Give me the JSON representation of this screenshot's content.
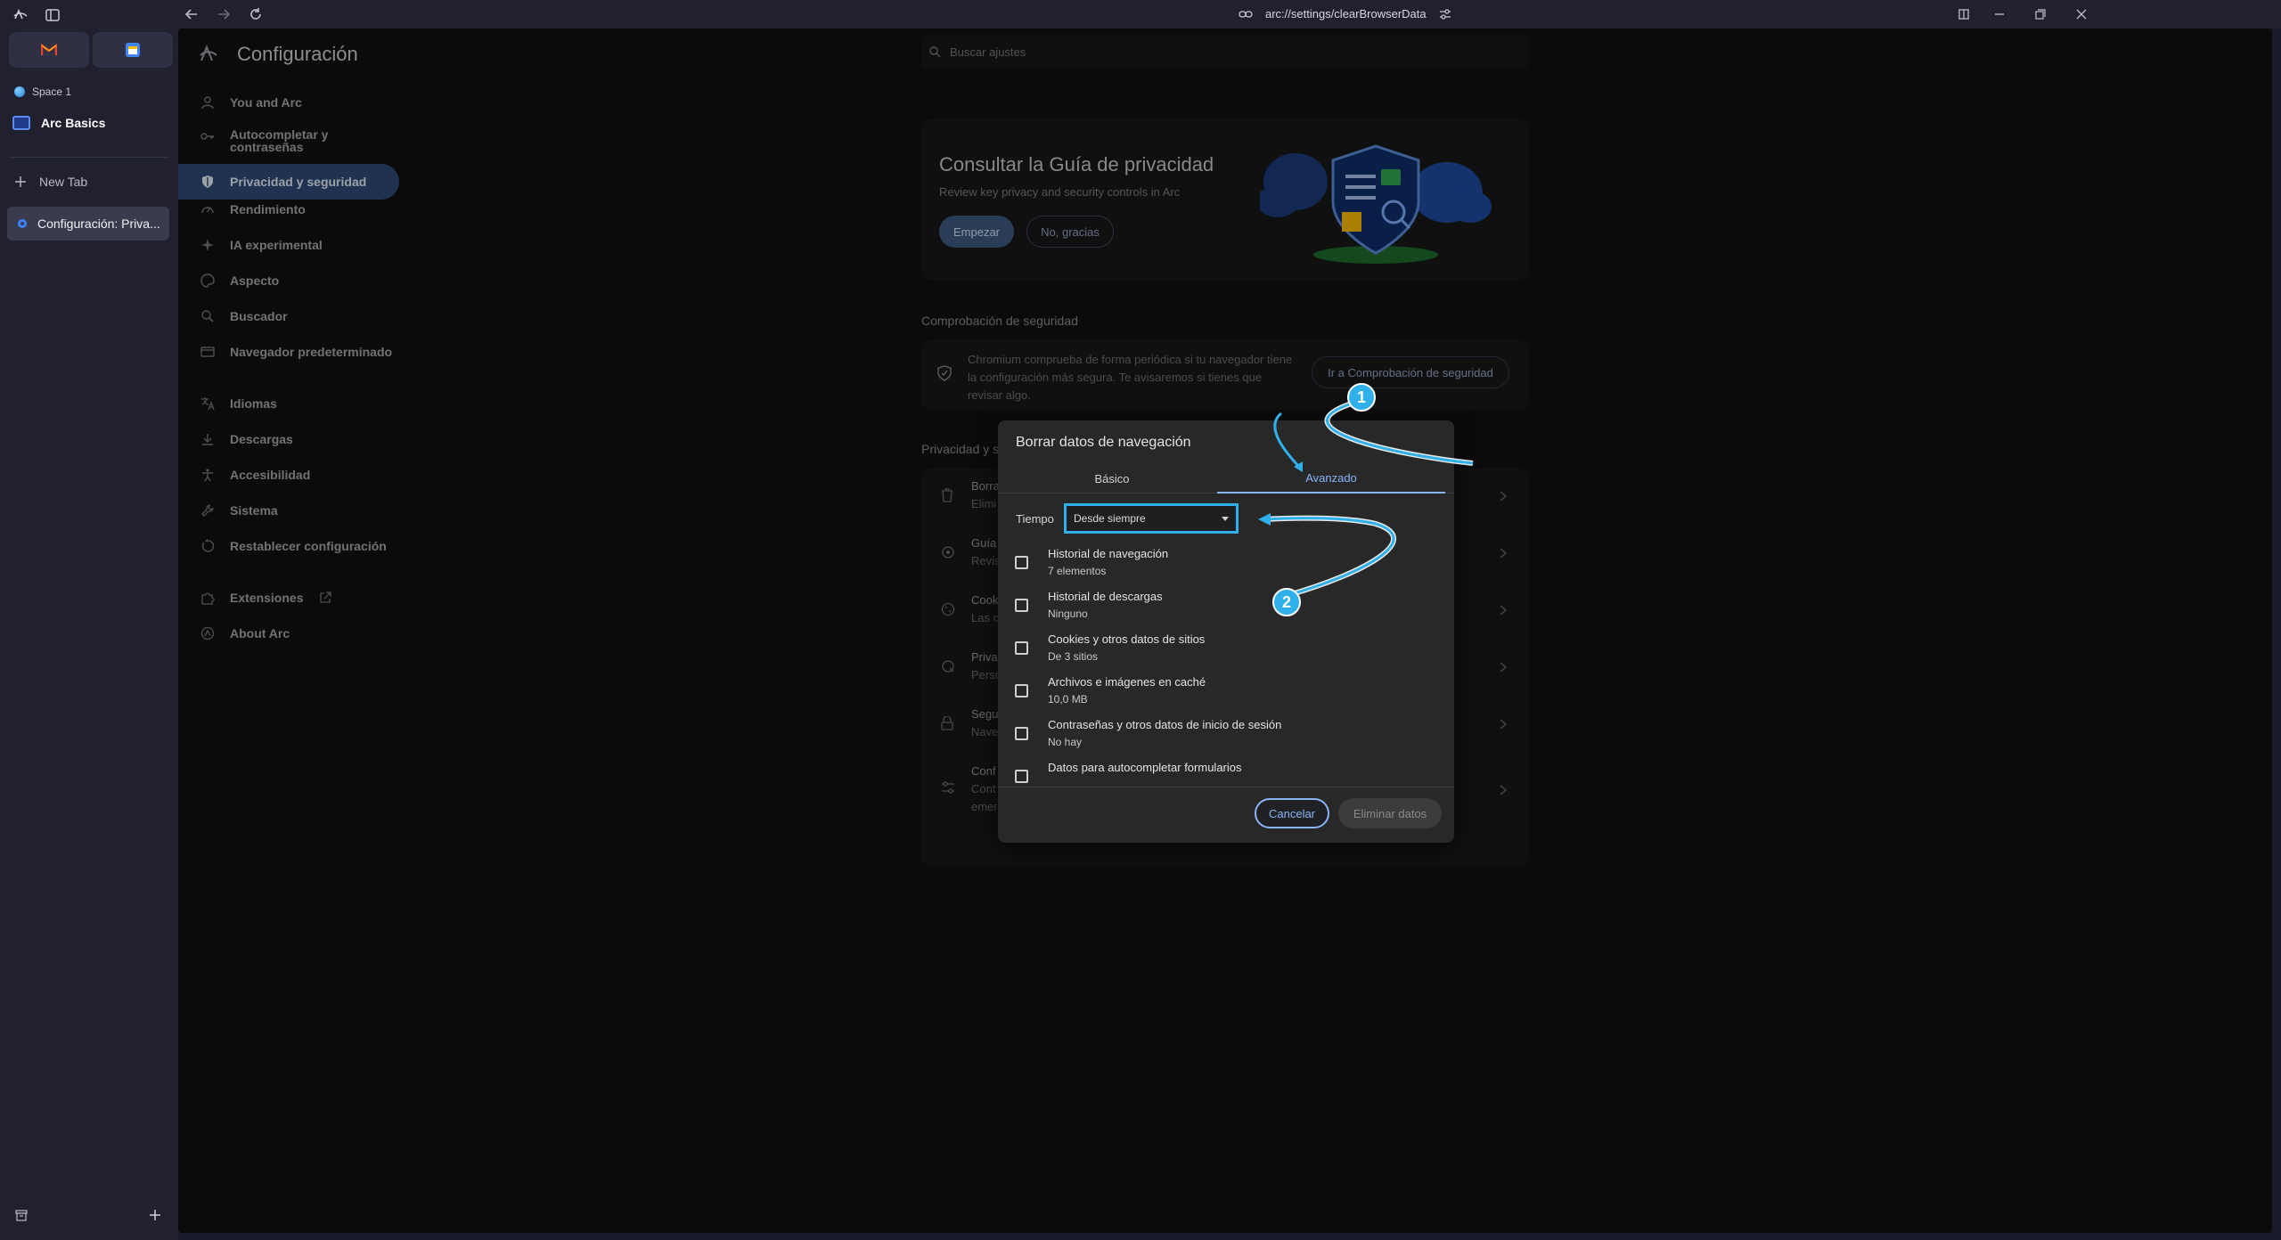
{
  "browser": {
    "url": "arc://settings/clearBrowserData",
    "space_name": "Space 1",
    "folder_name": "Arc Basics",
    "new_tab_label": "New Tab",
    "active_tab_label": "Configuración: Priva..."
  },
  "settings": {
    "title": "Configuración",
    "search_placeholder": "Buscar ajustes",
    "menu": [
      {
        "label": "You and Arc",
        "icon": "person-icon"
      },
      {
        "label": "Autocompletar y contraseñas",
        "icon": "key-icon"
      },
      {
        "label": "Privacidad y seguridad",
        "icon": "shield-icon",
        "active": true
      },
      {
        "label": "Rendimiento",
        "icon": "gauge-icon"
      },
      {
        "label": "IA experimental",
        "icon": "sparkle-icon"
      },
      {
        "label": "Aspecto",
        "icon": "palette-icon"
      },
      {
        "label": "Buscador",
        "icon": "search-icon"
      },
      {
        "label": "Navegador predeterminado",
        "icon": "browser-icon"
      },
      {
        "label": "Idiomas",
        "icon": "translate-icon"
      },
      {
        "label": "Descargas",
        "icon": "download-icon"
      },
      {
        "label": "Accesibilidad",
        "icon": "accessibility-icon"
      },
      {
        "label": "Sistema",
        "icon": "wrench-icon"
      },
      {
        "label": "Restablecer configuración",
        "icon": "reset-icon"
      },
      {
        "label": "Extensiones",
        "icon": "puzzle-icon"
      },
      {
        "label": "About Arc",
        "icon": "arc-icon"
      }
    ]
  },
  "privacy_guide": {
    "title": "Consultar la Guía de privacidad",
    "subtitle": "Review key privacy and security controls in Arc",
    "start_button": "Empezar",
    "no_thanks_button": "No, gracias"
  },
  "safety_check": {
    "section_title": "Comprobación de seguridad",
    "text": "Chromium comprueba de forma periódica si tu navegador tiene la configuración más segura. Te avisaremos si tienes que revisar algo.",
    "button": "Ir a Comprobación de seguridad"
  },
  "privacy_section": {
    "title_fragment": "Privacidad y s",
    "rows": [
      {
        "line1": "Borra",
        "line2": "Elimi"
      },
      {
        "line1": "Guía",
        "line2": "Revis"
      },
      {
        "line1": "Cook",
        "line2": "Las c"
      },
      {
        "line1": "Priva",
        "line2": "Perso"
      },
      {
        "line1": "Segu",
        "line2": "Nave"
      },
      {
        "line1": "Conf",
        "line2": "Cont",
        "line3": "emer"
      }
    ]
  },
  "dialog": {
    "title": "Borrar datos de navegación",
    "tab_basic": "Básico",
    "tab_advanced": "Avanzado",
    "time_label": "Tiempo",
    "time_value": "Desde siempre",
    "options": [
      {
        "label": "Historial de navegación",
        "sub": "7 elementos",
        "checked": false
      },
      {
        "label": "Historial de descargas",
        "sub": "Ninguno",
        "checked": false
      },
      {
        "label": "Cookies y otros datos de sitios",
        "sub": "De 3 sitios",
        "checked": false
      },
      {
        "label": "Archivos e imágenes en caché",
        "sub": "10,0 MB",
        "checked": false
      },
      {
        "label": "Contraseñas y otros datos de inicio de sesión",
        "sub": "No hay",
        "checked": false
      },
      {
        "label": "Datos para autocompletar formularios",
        "sub": "",
        "checked": false
      }
    ],
    "cancel_button": "Cancelar",
    "delete_button": "Eliminar datos"
  },
  "annotations": {
    "badge1": "1",
    "badge2": "2",
    "color": "#2fb0ea"
  }
}
